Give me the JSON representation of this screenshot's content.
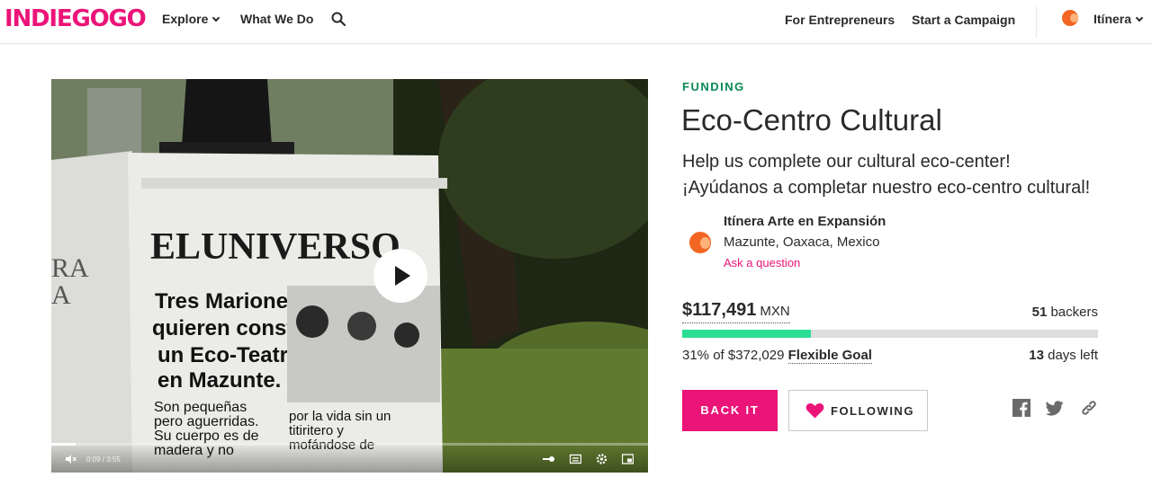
{
  "header": {
    "logo": "INDIEGOGO",
    "nav": {
      "explore": "Explore",
      "what_we_do": "What We Do"
    },
    "for_entrepreneurs": "For Entrepreneurs",
    "start_campaign": "Start a Campaign",
    "user_name": "Itínera"
  },
  "video": {
    "time": "0:09 / 3:55",
    "progress_fraction": 0.04
  },
  "campaign": {
    "status": "FUNDING",
    "title": "Eco-Centro Cultural",
    "tagline_en": "Help us complete our cultural eco-center!",
    "tagline_es": "¡Ayúdanos a completar nuestro eco-centro cultural!",
    "owner": {
      "name": "Itínera Arte en Expansión",
      "location": "Mazunte, Oaxaca, Mexico",
      "ask": "Ask a question"
    },
    "raised": "$117,491",
    "currency": "MXN",
    "backers_count": "51",
    "backers_label": "backers",
    "percent_funded": 0.31,
    "goal_text": "31% of $372,029",
    "goal_type": "Flexible Goal",
    "days_count": "13",
    "days_label": "days left"
  },
  "actions": {
    "back_label": "BACK IT",
    "follow_label": "FOLLOWING"
  },
  "colors": {
    "brand": "#eb1478",
    "funding_green": "#0a8a55",
    "progress_green": "#2bde93"
  },
  "icons": [
    "search-icon",
    "chevron-down-icon",
    "play-icon",
    "mute-icon",
    "settings-icon",
    "captions-icon",
    "pip-icon",
    "heart-icon",
    "facebook-icon",
    "twitter-icon",
    "link-icon"
  ]
}
